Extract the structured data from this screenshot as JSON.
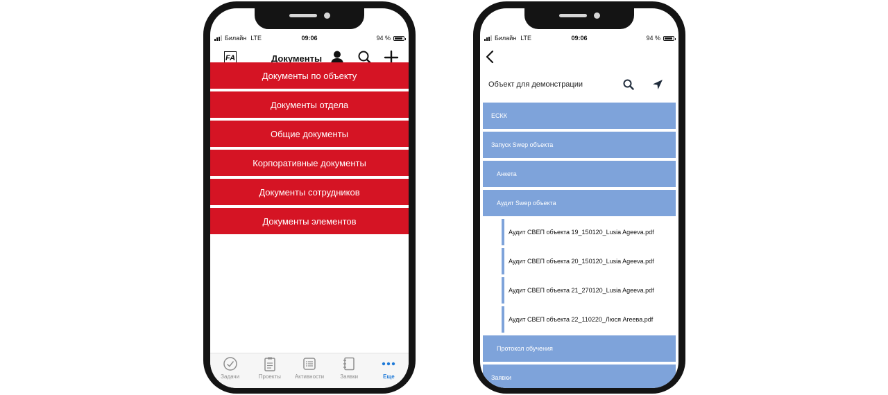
{
  "colors": {
    "menu_red": "#d51424",
    "tree_blue": "#7ea3da",
    "tab_active": "#1f7ad8",
    "tab_inactive": "#8e8e8e"
  },
  "left_phone": {
    "status": {
      "carrier": "Билайн",
      "network": "LTE",
      "time": "09:06",
      "battery": "94 %"
    },
    "header": {
      "logo": "FA",
      "title": "Документы",
      "icons": [
        "user-icon",
        "search-icon",
        "plus-icon"
      ]
    },
    "menu": [
      {
        "label": "Документы по объекту"
      },
      {
        "label": "Документы отдела"
      },
      {
        "label": "Общие документы"
      },
      {
        "label": "Корпоративные документы"
      },
      {
        "label": "Документы сотрудников"
      },
      {
        "label": "Документы элементов"
      }
    ],
    "tabs": [
      {
        "label": "Задачи",
        "icon": "check-circle-icon"
      },
      {
        "label": "Проекты",
        "icon": "clipboard-icon"
      },
      {
        "label": "Активности",
        "icon": "list-icon"
      },
      {
        "label": "Заявки",
        "icon": "notebook-icon"
      },
      {
        "label": "Еще",
        "icon": "more-dots-icon"
      }
    ]
  },
  "right_phone": {
    "status": {
      "carrier": "Билайн",
      "network": "LTE",
      "time": "09:06",
      "battery": "94 %"
    },
    "object_title": "Объект для демонстрации",
    "tree": [
      {
        "type": "folder",
        "level": 0,
        "label": "ЕСКК"
      },
      {
        "type": "folder",
        "level": 0,
        "label": "Запуск Swep объекта"
      },
      {
        "type": "folder",
        "level": 1,
        "label": "Анкета"
      },
      {
        "type": "folder",
        "level": 1,
        "label": "Аудит Swep объекта"
      },
      {
        "type": "file",
        "label": "Аудит СВЕП объекта 19_150120_Lusia Ageeva.pdf"
      },
      {
        "type": "file",
        "label": "Аудит СВЕП объекта 20_150120_Lusia Ageeva.pdf"
      },
      {
        "type": "file",
        "label": "Аудит СВЕП объекта 21_270120_Lusia Ageeva.pdf"
      },
      {
        "type": "file",
        "label": "Аудит СВЕП объекта 22_110220_Люся Агеева.pdf"
      },
      {
        "type": "folder",
        "level": 1,
        "label": "Протокол обучения"
      },
      {
        "type": "folder",
        "level": 0,
        "label": "Заявки"
      }
    ]
  }
}
